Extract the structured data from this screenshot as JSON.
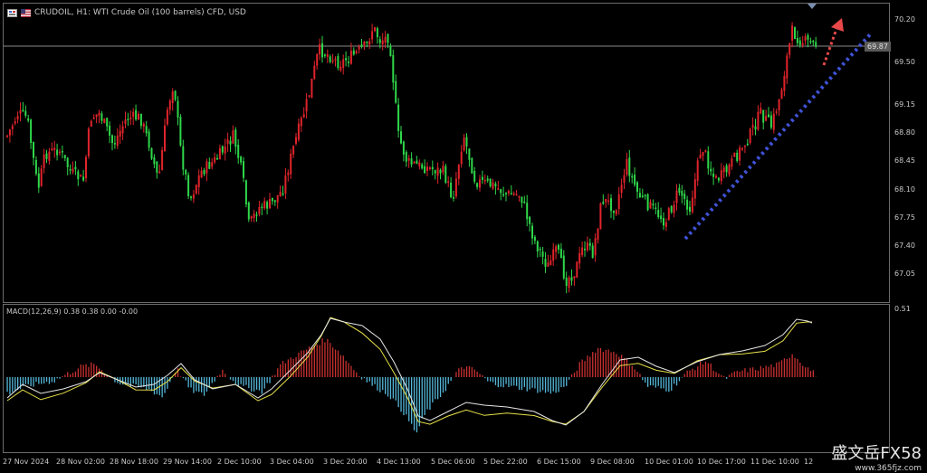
{
  "window": {
    "title": "CRUDOIL, H1: WTI Crude Oil (100 barrels) CFD, USD"
  },
  "main_chart": {
    "price_axis": [
      "70.20",
      "69.50",
      "69.15",
      "68.80",
      "68.45",
      "68.10",
      "67.75",
      "67.40",
      "67.05"
    ],
    "current_price": "69.87",
    "colors": {
      "up": "#e0242b",
      "down": "#2fd74a",
      "trend_line": "#3f52d8",
      "arrow": "#e84848"
    }
  },
  "macd": {
    "label": "MACD(12,26,9) 0.38 0.38 0.00 -0.00",
    "axis_top": "0.51",
    "colors": {
      "hist_pos": "#c93030",
      "hist_neg": "#54b6d8",
      "macd": "#e6e6e6",
      "signal": "#e8e24a"
    }
  },
  "time_axis": [
    "27 Nov 2024",
    "28 Nov 02:00",
    "28 Nov 18:00",
    "29 Nov 14:00",
    "2 Dec 10:00",
    "3 Dec 04:00",
    "3 Dec 20:00",
    "4 Dec 13:00",
    "5 Dec 06:00",
    "5 Dec 22:00",
    "6 Dec 15:00",
    "9 Dec 08:00",
    "10 Dec 01:00",
    "10 Dec 17:00",
    "11 Dec 10:00",
    "12"
  ],
  "watermark": {
    "text": "盛文岳FX58",
    "url": "www.365fjz.com"
  }
}
